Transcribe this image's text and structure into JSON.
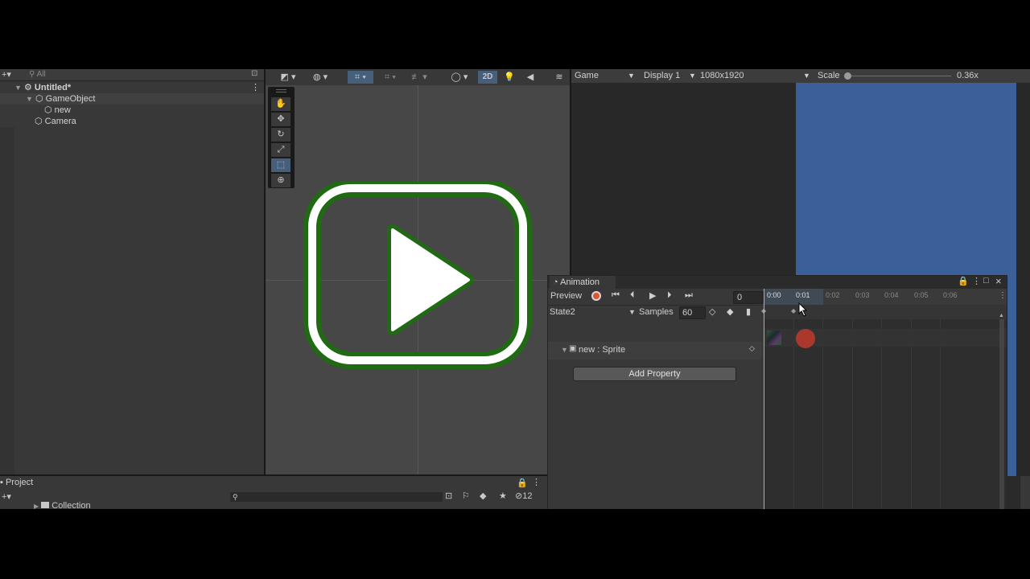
{
  "hierarchy": {
    "search_placeholder": "All",
    "scene_name": "Untitled*",
    "items": [
      {
        "label": "GameObject",
        "depth": 1
      },
      {
        "label": "new",
        "depth": 2
      },
      {
        "label": "Camera",
        "depth": 1
      }
    ]
  },
  "scene_toolbar": {
    "mode_2d": "2D"
  },
  "game_view": {
    "tab": "Game",
    "display": "Display 1",
    "resolution": "1080x1920",
    "scale_label": "Scale",
    "scale_value": "0.36x",
    "scale_fraction": 0.02
  },
  "animation": {
    "title": "Animation",
    "preview_label": "Preview",
    "frame": "0",
    "state": "State2",
    "samples_label": "Samples",
    "samples": "60",
    "property": "new : Sprite",
    "add_property": "Add Property",
    "timeline_ticks": [
      "0:00",
      "0:01",
      "0:02",
      "0:03",
      "0:04",
      "0:05",
      "0:06"
    ]
  },
  "project": {
    "tab": "Project",
    "folder": "Collection",
    "hidden_count": "12"
  },
  "colors": {
    "record_red": "#e0532f",
    "accent_blue": "#46607c",
    "game_blue": "#3a5f99",
    "logo_green": "#1f6a12"
  }
}
